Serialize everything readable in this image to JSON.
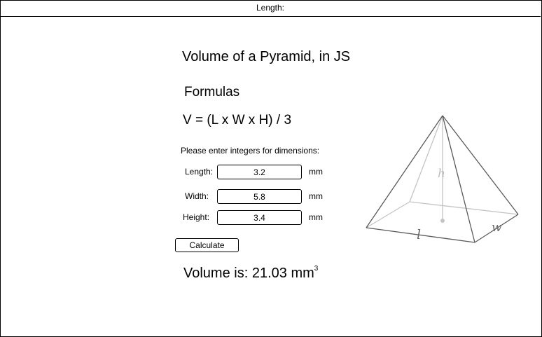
{
  "top_bar": {
    "label": "Length:"
  },
  "title": "Volume of a Pyramid, in JS",
  "formulas_heading": "Formulas",
  "formula": "V =  (L  x W x H) / 3",
  "instructions": "Please enter integers for dimensions:",
  "fields": {
    "length": {
      "label": "Length:",
      "value": "3.2",
      "unit": "mm"
    },
    "width": {
      "label": "Width:",
      "value": "5.8",
      "unit": "mm"
    },
    "height": {
      "label": "Height:",
      "value": "3.4",
      "unit": "mm"
    }
  },
  "calculate_label": "Calculate",
  "result": {
    "prefix": "Volume is: ",
    "value": "21.03",
    "unit": " mm",
    "exponent": "3"
  },
  "diagram": {
    "height_label": "h",
    "length_label": "l",
    "width_label": "w"
  },
  "colors": {
    "border": "#000000",
    "diagram_edge": "#5a5a5a",
    "diagram_hidden": "#bdbdbd"
  }
}
